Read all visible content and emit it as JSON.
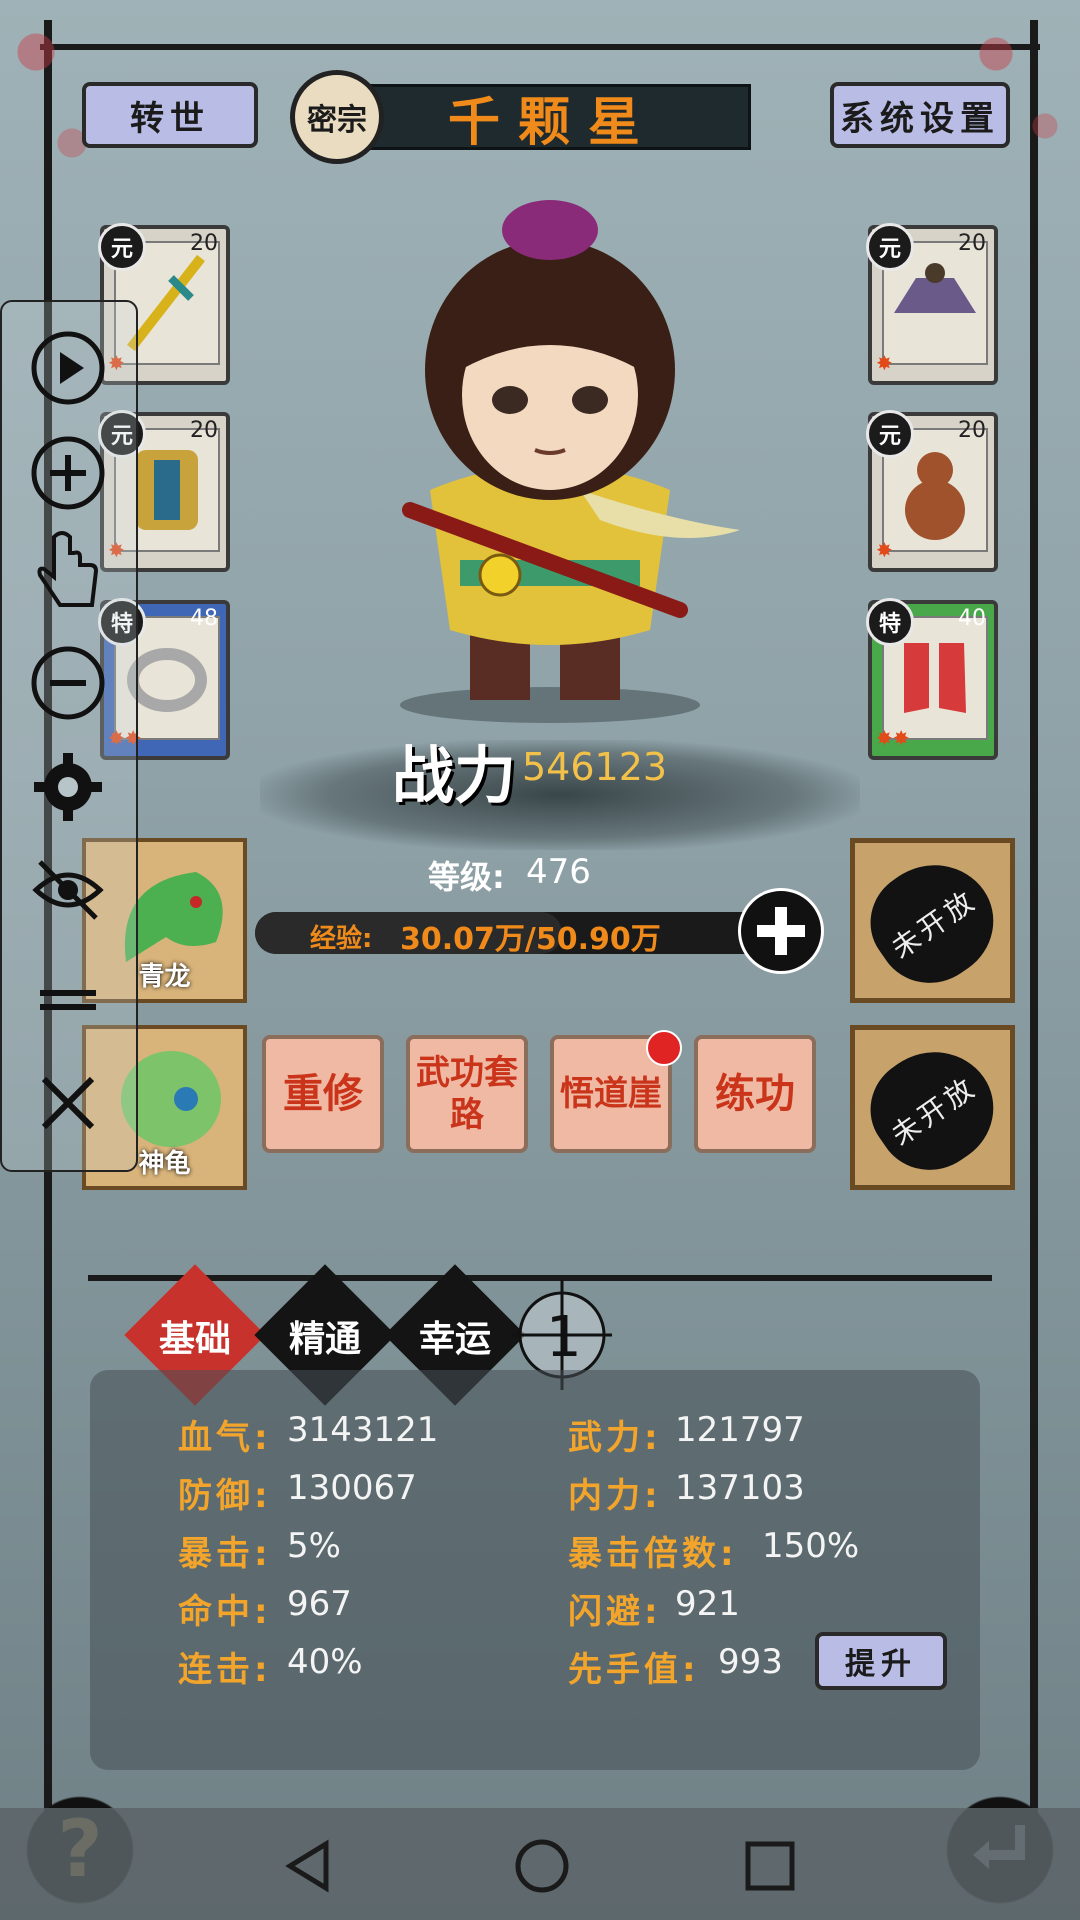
{
  "header": {
    "rebirth_label": "转世",
    "sect_label": "密宗",
    "player_name": "千颗星",
    "settings_label": "系统设置"
  },
  "equipment": {
    "left": [
      {
        "tag": "元",
        "level": "20",
        "item_icon": "sword-icon"
      },
      {
        "tag": "元",
        "level": "20",
        "item_icon": "armor-icon"
      },
      {
        "tag": "特",
        "level": "48",
        "item_icon": "ring-icon"
      }
    ],
    "right": [
      {
        "tag": "元",
        "level": "20",
        "item_icon": "hat-icon"
      },
      {
        "tag": "元",
        "level": "20",
        "item_icon": "gourd-icon"
      },
      {
        "tag": "特",
        "level": "40",
        "item_icon": "boots-icon"
      }
    ]
  },
  "combat": {
    "power_label": "战力",
    "power_value": "546123",
    "level_label": "等级:",
    "level_value": "476",
    "exp_label": "经验:",
    "exp_value": "30.07万/50.90万",
    "exp_fraction": 0.591
  },
  "pets": [
    {
      "name": "青龙"
    },
    {
      "name": "神龟"
    }
  ],
  "locked_label": "未开放",
  "skills": [
    {
      "label": "重修"
    },
    {
      "label": "武功套路"
    },
    {
      "label": "悟道崖"
    },
    {
      "label": "练功"
    }
  ],
  "tabs": [
    {
      "label": "基础",
      "active": true
    },
    {
      "label": "精通",
      "active": false
    },
    {
      "label": "幸运",
      "active": false
    }
  ],
  "crosshair_value": "1",
  "stats": {
    "hp_label": "血气:",
    "hp": "3143121",
    "def_label": "防御:",
    "def": "130067",
    "crit_label": "暴击:",
    "crit": "5%",
    "hit_label": "命中:",
    "hit": "967",
    "combo_label": "连击:",
    "combo": "40%",
    "atk_label": "武力:",
    "atk": "121797",
    "inner_label": "内力:",
    "inner": "137103",
    "critmul_label": "暴击倍数:",
    "critmul": "150%",
    "dodge_label": "闪避:",
    "dodge": "921",
    "init_label": "先手值:",
    "init": "993"
  },
  "upgrade_label": "提升",
  "help_label": "?",
  "colors": {
    "accent": "#f08a1a",
    "stat_label": "#f2a52a",
    "tab_active": "#c8322c",
    "tab_inactive": "#141414"
  }
}
